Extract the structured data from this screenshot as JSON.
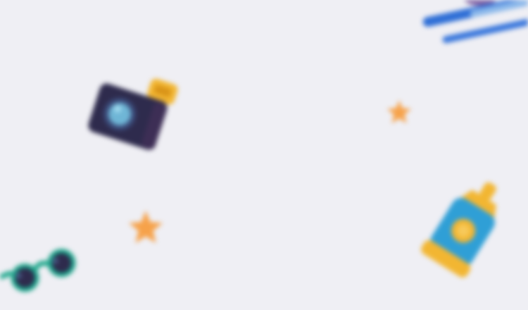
{
  "scene": {
    "background": "#efeff4",
    "decorations": [
      {
        "name": "camera-icon",
        "colors": {
          "body": "#2e2b4d",
          "lens": "#7fc3dd",
          "flash": "#f2b632"
        }
      },
      {
        "name": "star-icon",
        "colors": {
          "fill": "#f6a24a"
        }
      },
      {
        "name": "star-icon",
        "colors": {
          "fill": "#f6a24a"
        }
      },
      {
        "name": "sunglasses-icon",
        "colors": {
          "frame": "#1aa68a",
          "lens": "#2e2b4d"
        }
      },
      {
        "name": "sunscreen-bottle-icon",
        "colors": {
          "body": "#2f9fd6",
          "cap": "#f2b632",
          "label": "#f2b632"
        }
      },
      {
        "name": "stripes-icon",
        "colors": {
          "dark": "#2f6fd6",
          "light": "#8bb8ea",
          "accent": "#7a5aa0"
        }
      }
    ]
  }
}
